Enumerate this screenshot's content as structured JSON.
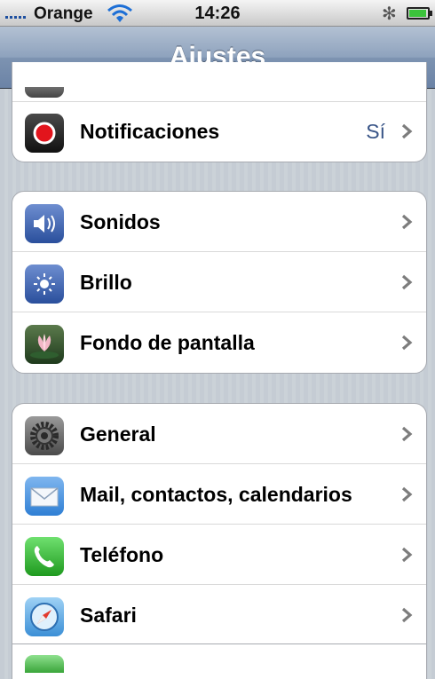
{
  "status": {
    "carrier": "Orange",
    "time": "14:26",
    "bluetooth_glyph": "✻",
    "battery_level": 0.95,
    "colors": {
      "battery": "#3cc43c",
      "signal": "#1d4fa0"
    }
  },
  "nav": {
    "title": "Ajustes"
  },
  "groups": {
    "g1": {
      "notifications": {
        "label": "Notificaciones",
        "value": "Sí",
        "icon": "notifications-icon"
      }
    },
    "g2": {
      "sounds": {
        "label": "Sonidos",
        "icon": "sounds-icon"
      },
      "brightness": {
        "label": "Brillo",
        "icon": "brightness-icon"
      },
      "wallpaper": {
        "label": "Fondo de pantalla",
        "icon": "wallpaper-icon"
      }
    },
    "g3": {
      "general": {
        "label": "General",
        "icon": "general-icon"
      },
      "mail": {
        "label": "Mail, contactos, calendarios",
        "icon": "mail-icon"
      },
      "phone": {
        "label": "Teléfono",
        "icon": "phone-icon"
      },
      "safari": {
        "label": "Safari",
        "icon": "safari-icon"
      }
    }
  },
  "theme": {
    "accent_value": "#385487",
    "nav_gradient_top": "#b3c1d3",
    "nav_gradient_bottom": "#6b83a6"
  }
}
